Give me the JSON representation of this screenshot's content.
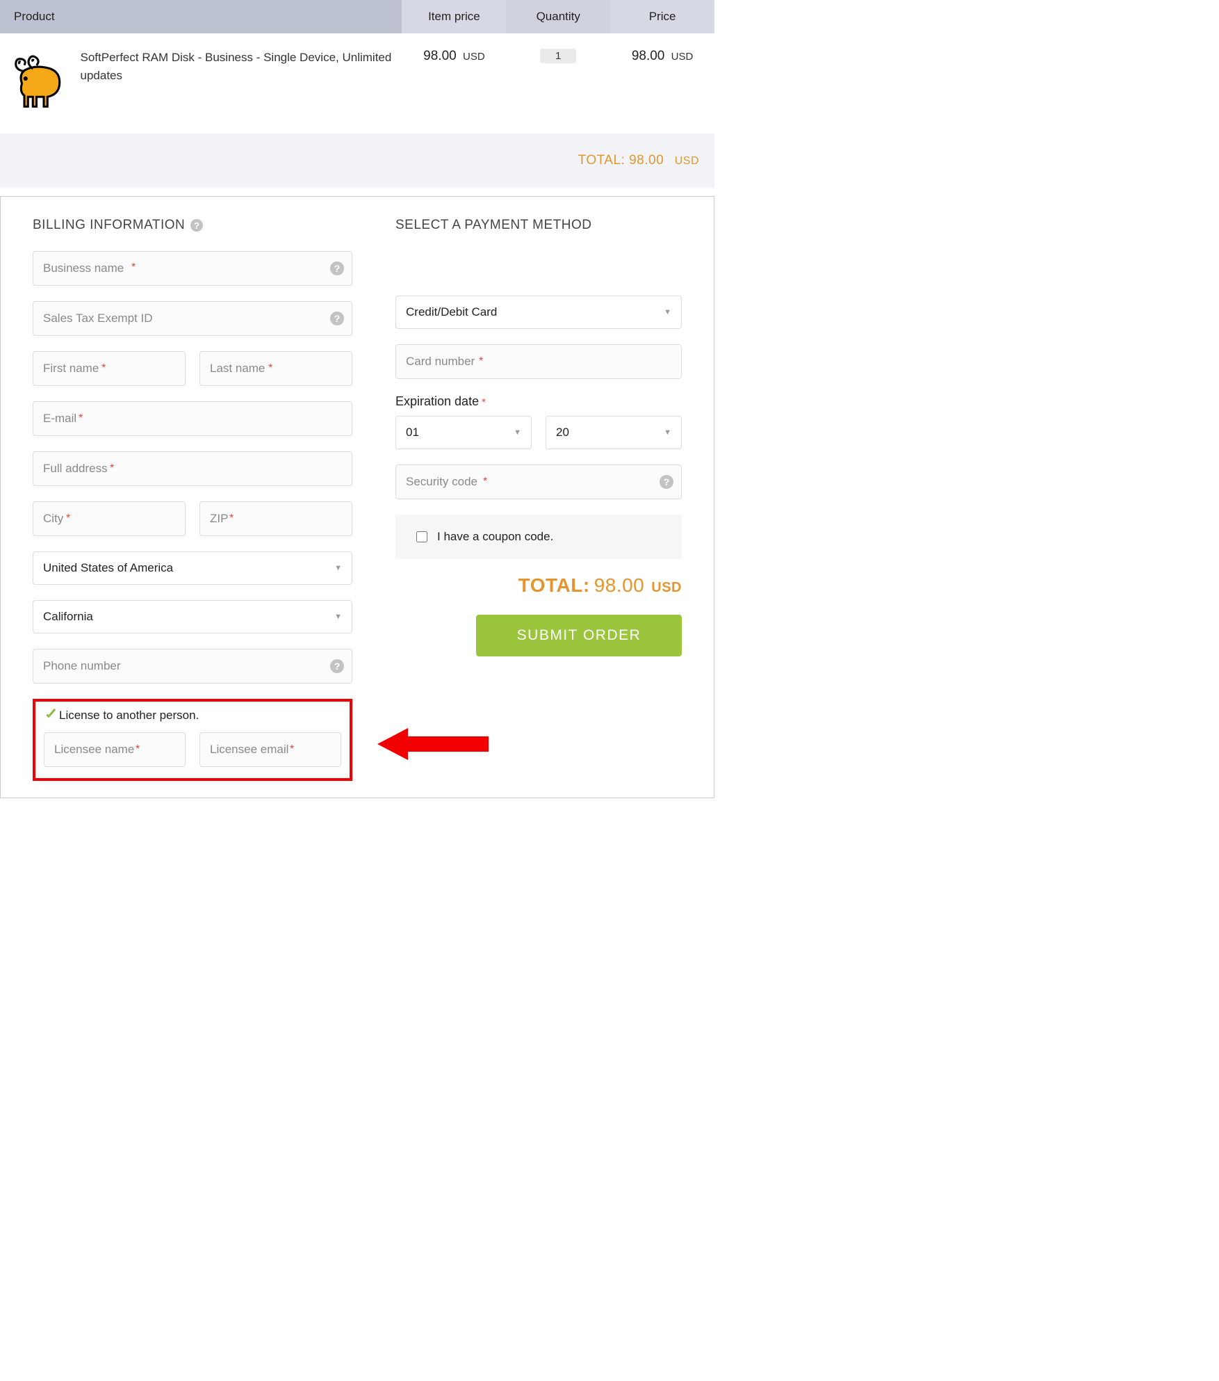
{
  "cart": {
    "headers": {
      "product": "Product",
      "item_price": "Item price",
      "quantity": "Quantity",
      "price": "Price"
    },
    "item": {
      "name": "SoftPerfect RAM Disk - Business - Single Device, Unlimited updates",
      "item_price": "98.00",
      "currency": "USD",
      "quantity": "1",
      "price": "98.00"
    },
    "total_label": "TOTAL:",
    "total_value": "98.00",
    "total_currency": "USD"
  },
  "billing": {
    "title": "BILLING INFORMATION",
    "business_name_ph": "Business name ",
    "tax_exempt_ph": "Sales Tax Exempt ID",
    "first_name_ph": "First name",
    "last_name_ph": "Last name",
    "email_ph": "E-mail",
    "address_ph": "Full address",
    "city_ph": "City",
    "zip_ph": "ZIP",
    "country": "United States of America",
    "state": "California",
    "phone_ph": "Phone number",
    "license_check": "License to another person.",
    "licensee_name_ph": "Licensee name",
    "licensee_email_ph": "Licensee email"
  },
  "payment": {
    "title": "SELECT A PAYMENT METHOD",
    "method": "Credit/Debit Card",
    "card_number_ph": "Card number",
    "exp_label": "Expiration date",
    "exp_month": "01",
    "exp_year": "20",
    "security_ph": "Security code",
    "coupon_label": "I have a coupon code.",
    "total_label": "TOTAL:",
    "total_value": "98.00",
    "total_currency": "USD",
    "submit": "SUBMIT ORDER"
  }
}
